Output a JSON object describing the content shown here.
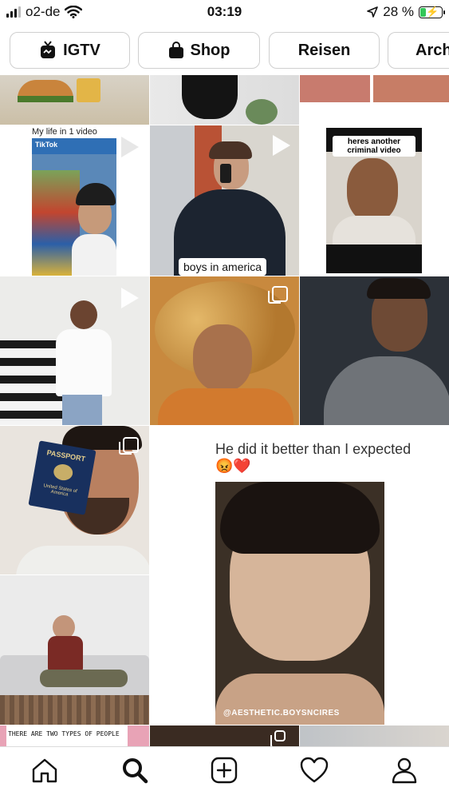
{
  "status_bar": {
    "carrier": "o2-de",
    "time": "03:19",
    "battery_percent": "28 %",
    "battery_level": 0.28,
    "battery_color": "#34c759"
  },
  "chips": [
    {
      "label": "IGTV",
      "icon": "igtv-icon"
    },
    {
      "label": "Shop",
      "icon": "shopping-bag-icon"
    },
    {
      "label": "Reisen",
      "icon": ""
    },
    {
      "label": "Arch",
      "icon": ""
    }
  ],
  "grid": {
    "tiktok_caption": "My life in 1 video",
    "tiktok_badge": "TikTok",
    "boys_in_america": "boys in america",
    "criminal_caption": "heres another criminal video",
    "he_did_it": "He did it better than I expected 😡❤️",
    "watermark": "@AESTHETIC.BOYSNCIRES",
    "two_types": "THERE ARE TWO TYPES OF PEOPLE",
    "passport": "PASSPORT",
    "passport_country": "United States of America"
  },
  "tabbar": [
    {
      "name": "home-icon"
    },
    {
      "name": "search-icon"
    },
    {
      "name": "new-post-icon"
    },
    {
      "name": "activity-heart-icon"
    },
    {
      "name": "profile-icon"
    }
  ]
}
